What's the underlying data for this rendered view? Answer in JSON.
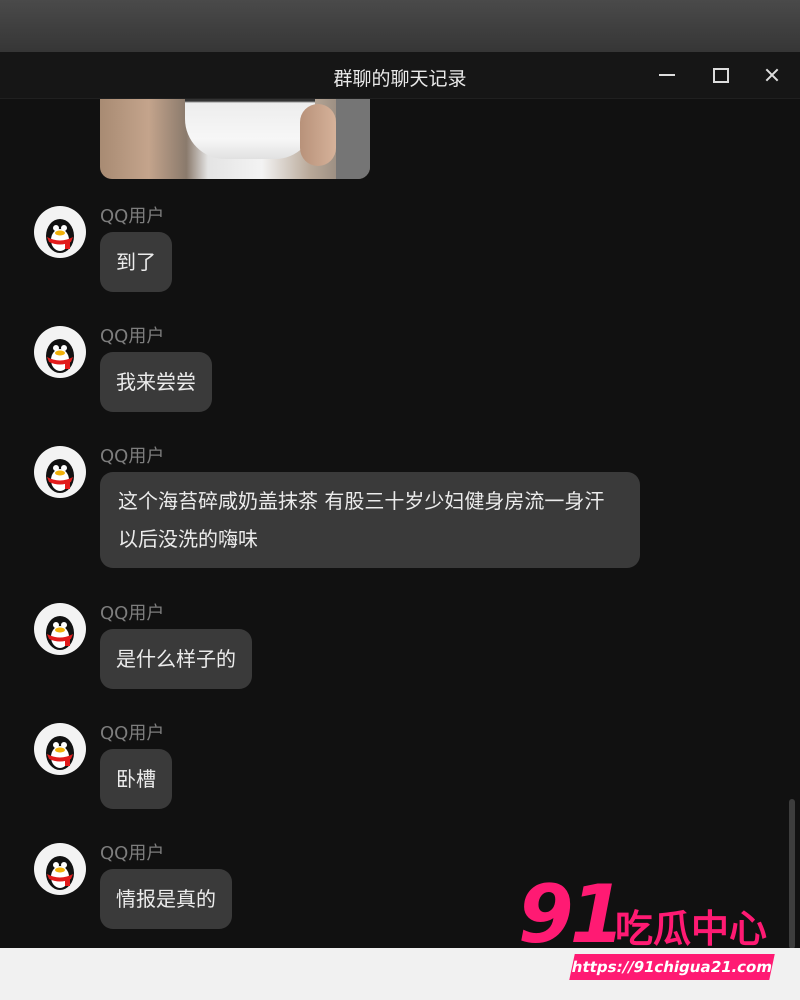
{
  "window": {
    "title": "群聊的聊天记录"
  },
  "messages": [
    {
      "sender": "QQ用户",
      "text": "到了"
    },
    {
      "sender": "QQ用户",
      "text": "我来尝尝"
    },
    {
      "sender": "QQ用户",
      "text": "这个海苔碎咸奶盖抹茶 有股三十岁少妇健身房流一身汗以后没洗的嗨味"
    },
    {
      "sender": "QQ用户",
      "text": "是什么样子的"
    },
    {
      "sender": "QQ用户",
      "text": "卧槽"
    },
    {
      "sender": "QQ用户",
      "text": "情报是真的"
    }
  ],
  "watermark": {
    "number": "91",
    "text": "吃瓜中心",
    "url": "https://91chigua21.com"
  },
  "colors": {
    "window_bg": "#111111",
    "bubble_bg": "#3a3a3a",
    "watermark": "#ff1a73"
  }
}
